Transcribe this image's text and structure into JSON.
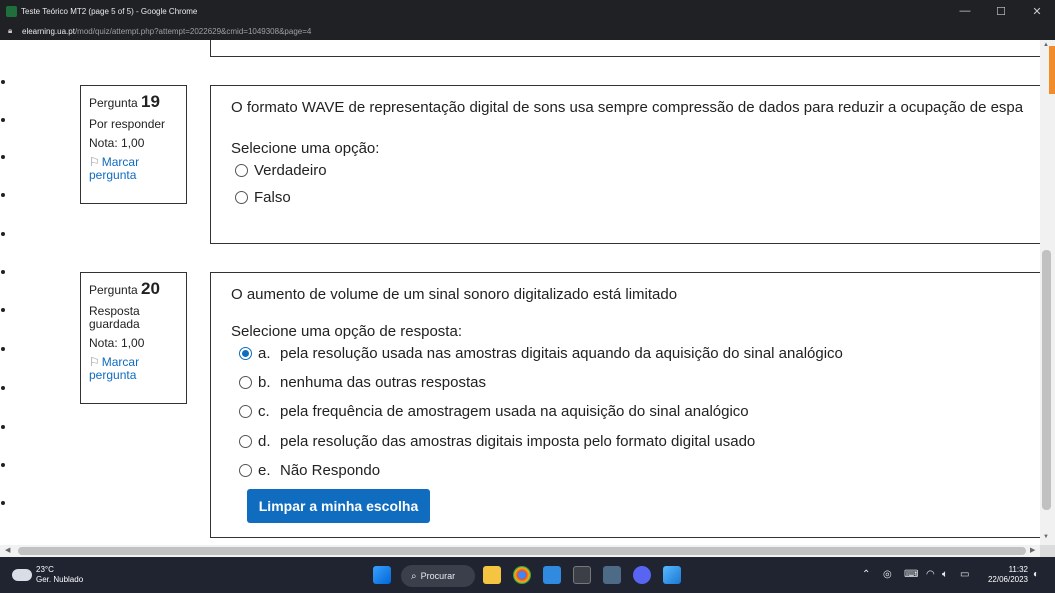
{
  "browser": {
    "window_title": "Teste Teórico MT2 (page 5 of 5) - Google Chrome",
    "url_host": "elearning.ua.pt",
    "url_path": "/mod/quiz/attempt.php?attempt=2022629&cmid=1049308&page=4",
    "minimize": "—",
    "maximize": "☐",
    "close": "✕"
  },
  "questions": [
    {
      "label": "Pergunta",
      "number": "19",
      "status": "Por responder",
      "grade": "Nota: 1,00",
      "flag_label": "Marcar pergunta",
      "text": "O formato WAVE de representação digital de sons usa sempre compressão de dados para reduzir a ocupação de espa",
      "prompt": "Selecione uma opção:",
      "options": [
        {
          "label": "Verdadeiro",
          "checked": false
        },
        {
          "label": "Falso",
          "checked": false
        }
      ]
    },
    {
      "label": "Pergunta",
      "number": "20",
      "status": "Resposta guardada",
      "grade": "Nota: 1,00",
      "flag_label": "Marcar pergunta",
      "text": "O aumento de volume de um sinal sonoro digitalizado está limitado",
      "prompt": "Selecione uma opção de resposta:",
      "options": [
        {
          "letter": "a.",
          "label": "pela resolução usada nas amostras digitais aquando da aquisição do sinal analógico",
          "checked": true
        },
        {
          "letter": "b.",
          "label": "nenhuma das outras respostas",
          "checked": false
        },
        {
          "letter": "c.",
          "label": "pela frequência de amostragem usada na aquisição do sinal analógico",
          "checked": false
        },
        {
          "letter": "d.",
          "label": "pela resolução das amostras digitais imposta pelo formato digital usado",
          "checked": false
        },
        {
          "letter": "e.",
          "label": "Não Respondo",
          "checked": false
        }
      ],
      "clear_button": "Limpar a minha escolha"
    }
  ],
  "taskbar": {
    "temperature": "23°C",
    "weather": "Ger. Nublado",
    "search_label": "Procurar",
    "time": "11:32",
    "date": "22/06/2023"
  },
  "colors": {
    "accent": "#0f6cbf",
    "taskbar": "#1f2430",
    "titlebar": "#202124"
  }
}
